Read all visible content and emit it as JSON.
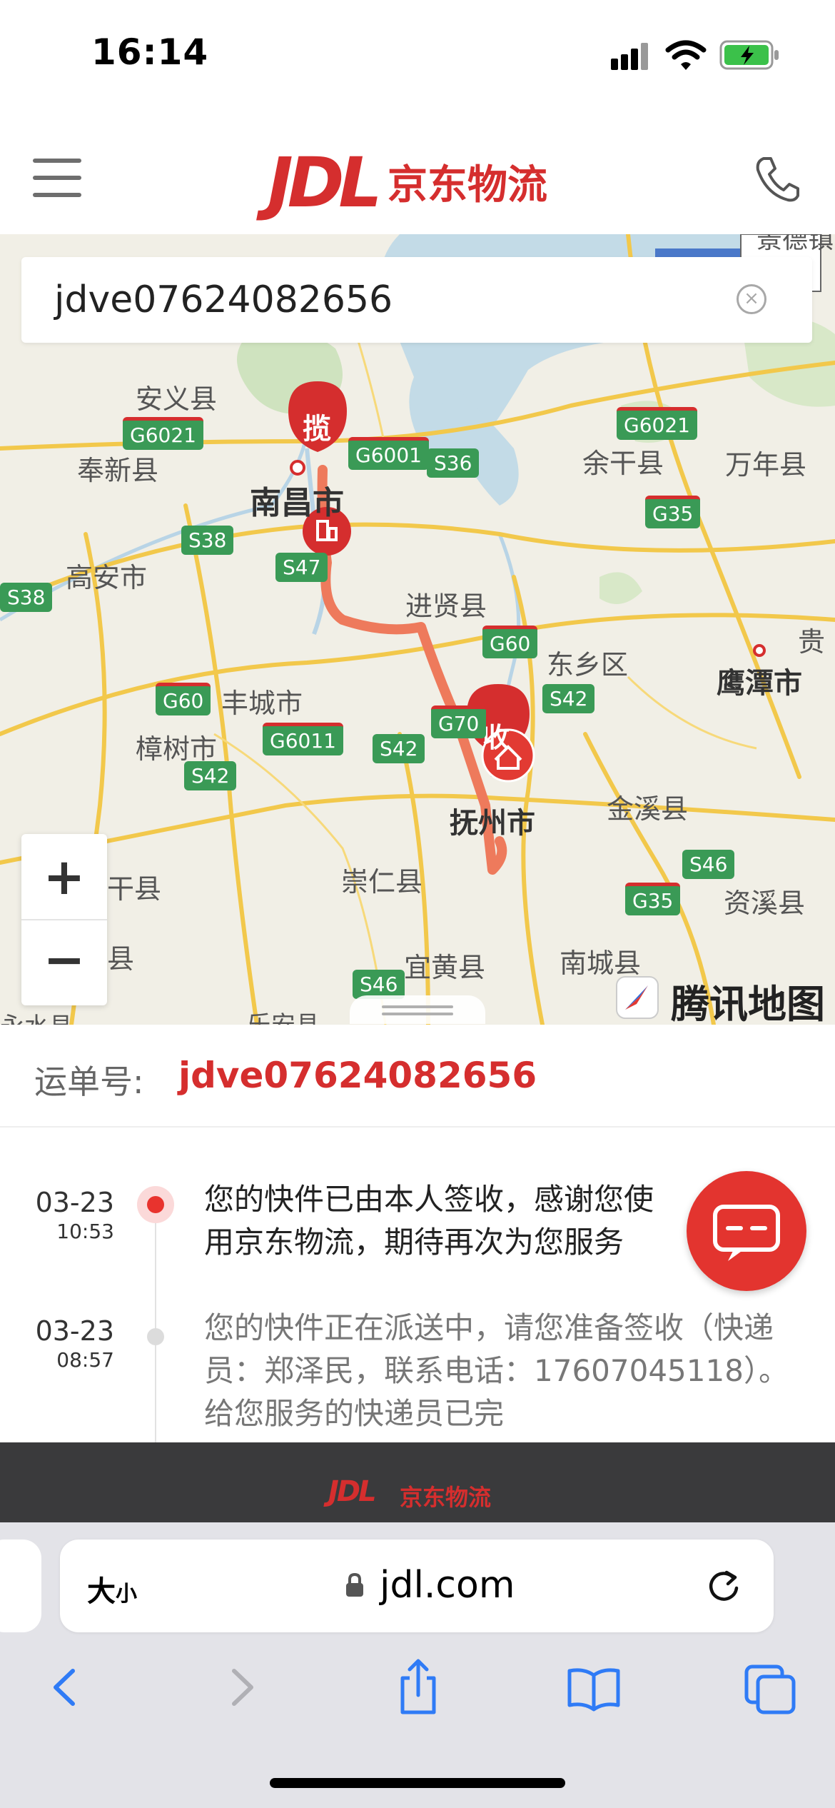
{
  "status_bar": {
    "time": "16:14"
  },
  "header": {
    "logo": "JDL",
    "brand": "京东物流"
  },
  "search": {
    "value": "jdve07624082656"
  },
  "map": {
    "places": [
      {
        "id": "anyi",
        "name": "安义县"
      },
      {
        "id": "fengxin",
        "name": "奉新县"
      },
      {
        "id": "nanchang",
        "name": "南昌市"
      },
      {
        "id": "gaoan",
        "name": "高安市"
      },
      {
        "id": "jinxian",
        "name": "进贤县"
      },
      {
        "id": "dongxiang",
        "name": "东乡区"
      },
      {
        "id": "yugan",
        "name": "余干县"
      },
      {
        "id": "wannian",
        "name": "万年县"
      },
      {
        "id": "yingtan",
        "name": "鹰潭市"
      },
      {
        "id": "gui",
        "name": "贵"
      },
      {
        "id": "fengcheng",
        "name": "丰城市"
      },
      {
        "id": "zhangshu",
        "name": "樟树市"
      },
      {
        "id": "fuzhou",
        "name": "抚州市"
      },
      {
        "id": "jinxi",
        "name": "金溪县"
      },
      {
        "id": "chongren",
        "name": "崇仁县"
      },
      {
        "id": "zixi",
        "name": "资溪县"
      },
      {
        "id": "ganxian",
        "name": "干县"
      },
      {
        "id": "yihuang",
        "name": "宜黄县"
      },
      {
        "id": "nancheng",
        "name": "南城县"
      },
      {
        "id": "xian2",
        "name": "县"
      },
      {
        "id": "leian",
        "name": "乐安县"
      },
      {
        "id": "yongshui",
        "name": "永水县"
      },
      {
        "id": "jingde",
        "name": "景德镇"
      }
    ],
    "highways": [
      {
        "id": "g6021a",
        "name": "G6021"
      },
      {
        "id": "g6001",
        "name": "G6001"
      },
      {
        "id": "s36",
        "name": "S36"
      },
      {
        "id": "g6021b",
        "name": "G6021"
      },
      {
        "id": "g35a",
        "name": "G35"
      },
      {
        "id": "s38a",
        "name": "S38"
      },
      {
        "id": "s47",
        "name": "S47"
      },
      {
        "id": "s38b",
        "name": "S38"
      },
      {
        "id": "g60a",
        "name": "G60"
      },
      {
        "id": "g60b",
        "name": "G60"
      },
      {
        "id": "s42a",
        "name": "S42"
      },
      {
        "id": "g6011",
        "name": "G6011"
      },
      {
        "id": "s42b",
        "name": "S42"
      },
      {
        "id": "s42c",
        "name": "S42"
      },
      {
        "id": "g70",
        "name": "G70"
      },
      {
        "id": "s46a",
        "name": "S46"
      },
      {
        "id": "g35b",
        "name": "G35"
      },
      {
        "id": "s46b",
        "name": "S46"
      }
    ],
    "marker_pickup": "揽",
    "marker_deliver": "收",
    "provider": "腾讯地图",
    "zoom_in": "+",
    "zoom_out": "−"
  },
  "waybill": {
    "label": "运单号:",
    "number": "jdve07624082656"
  },
  "timeline": [
    {
      "date": "03-23",
      "time": "10:53",
      "text": "您的快件已由本人签收，感谢您使用京东物流，期待再次为您服务"
    },
    {
      "date": "03-23",
      "time": "08:57",
      "text": "您的快件正在派送中，请您准备签收（快递员：郑泽民，联系电话：17607045118）。给您服务的快递员已完"
    }
  ],
  "footer": {
    "logo": "JDL",
    "brand": "京东物流"
  },
  "browser": {
    "text_size_big": "大",
    "text_size_small": "小",
    "url": "jdl.com"
  },
  "colors": {
    "brand_red": "#d52e2e",
    "route": "#ee7a5c",
    "highway_green": "#3a9a56"
  }
}
